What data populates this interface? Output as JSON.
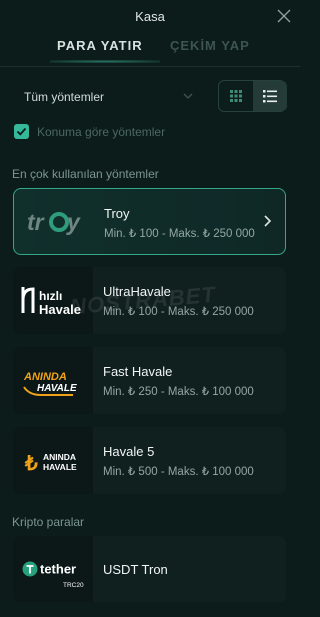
{
  "header": {
    "title": "Kasa",
    "tabs": [
      {
        "label": "PARA YATIR",
        "active": true
      },
      {
        "label": "ÇEKİM YAP",
        "active": false
      }
    ]
  },
  "filter": {
    "selected": "Tüm yöntemler",
    "view_modes": [
      "grid",
      "list"
    ],
    "active_view": "list",
    "location_checkbox": {
      "label": "Konuma göre yöntemler",
      "checked": true
    }
  },
  "sections": [
    {
      "title": "En çok kullanılan yöntemler",
      "methods": [
        {
          "name": "Troy",
          "limits": "Min. ₺ 100 - Maks. ₺ 250 000",
          "logo": "troy-logo",
          "featured": true
        },
        {
          "name": "UltraHavale",
          "limits": "Min. ₺ 100 - Maks. ₺ 250 000",
          "logo": "hizli-havale-logo",
          "logo_text": [
            "hızlı",
            "Havale"
          ]
        },
        {
          "name": "Fast Havale",
          "limits": "Min. ₺ 250 - Maks. ₺ 100 000",
          "logo": "aninda-havale-logo",
          "logo_text": [
            "ANINDA",
            "HAVALE"
          ]
        },
        {
          "name": "Havale 5",
          "limits": "Min. ₺ 500 - Maks. ₺ 100 000",
          "logo": "aninda-havale-lira-logo",
          "logo_text": [
            "ANINDA",
            "HAVALE"
          ]
        }
      ]
    },
    {
      "title": "Kripto paralar",
      "methods": [
        {
          "name": "USDT Tron",
          "limits": "",
          "logo": "tether-logo",
          "logo_text": [
            "tether",
            "TRC20"
          ]
        }
      ]
    }
  ],
  "watermark": "NOSTRABET",
  "colors": {
    "background": "#0b1c1b",
    "accent": "#36b89a",
    "card": "#10201f",
    "featured_border": "#36a88a"
  }
}
